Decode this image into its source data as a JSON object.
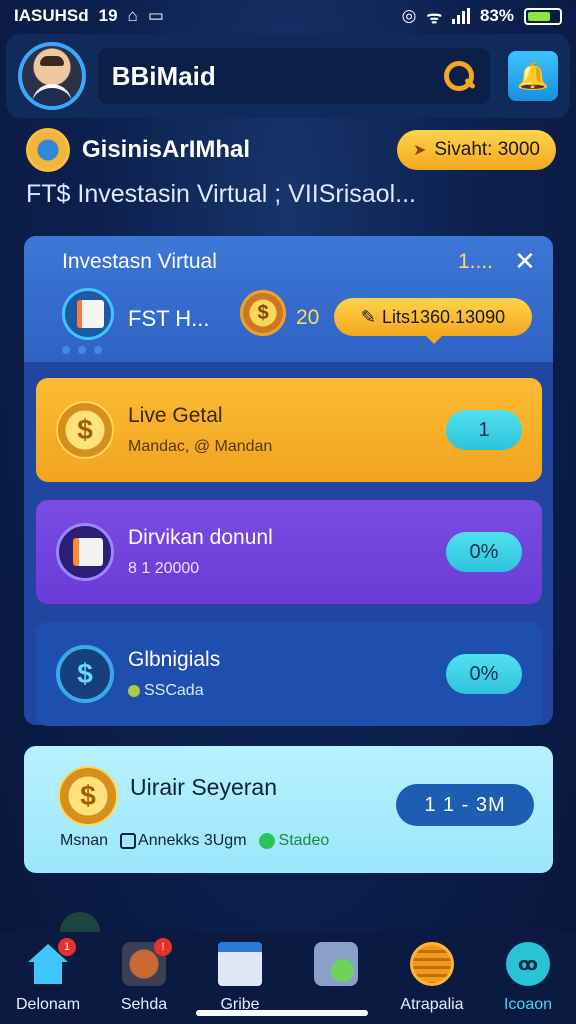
{
  "status_bar": {
    "left": "IASUHSd",
    "time": "19",
    "battery": "83%"
  },
  "header": {
    "search_text": "BBiMaid"
  },
  "brand": {
    "name": "GisinisArIMhal",
    "balance": "Sivaht: 3000"
  },
  "subheading": "FT$ Investasin Virtual ; VIISrisaol...",
  "panel": {
    "title": "Investasn Virtual",
    "count": "1....",
    "close": "✕",
    "fsi_label": "FST  H...",
    "coin_symbol": "$",
    "coin_count": "20",
    "tooltip": "Lits1360.13090"
  },
  "cards": [
    {
      "title": "Live Getal",
      "subtitle": "Mandac, @ Mandan",
      "badge": "1",
      "icon": "dollar-coin-icon"
    },
    {
      "title": "Dirvikan donunl",
      "subtitle": "8 1 20000",
      "badge": "0%",
      "icon": "documents-icon"
    },
    {
      "title": "Glbnigials",
      "subtitle": "SSCada",
      "badge": "0%",
      "icon": "shield-icon"
    }
  ],
  "bottom_card": {
    "title": "Uirair Seyeran",
    "badge": "1  1 - 3M",
    "meta_1": "Msnan",
    "meta_2": "Annekks 3Ugm",
    "meta_3": "Stadeo"
  },
  "tabs": [
    {
      "label": "Delonam",
      "icon": "home-icon",
      "badge": "1",
      "active": false
    },
    {
      "label": "Sehda",
      "icon": "basket-icon",
      "badge": "!",
      "active": false
    },
    {
      "label": "Gribe",
      "icon": "window-icon",
      "badge": "",
      "active": false
    },
    {
      "label": "",
      "icon": "coins-icon",
      "badge": "",
      "active": false
    },
    {
      "label": "Atrapalia",
      "icon": "list-icon",
      "badge": "",
      "active": false
    },
    {
      "label": "Icoaon",
      "icon": "people-icon",
      "badge": "",
      "active": true
    }
  ],
  "colors": {
    "accent": "#f5a623",
    "active_tab": "#40d8f0",
    "background": "#0d2150"
  }
}
